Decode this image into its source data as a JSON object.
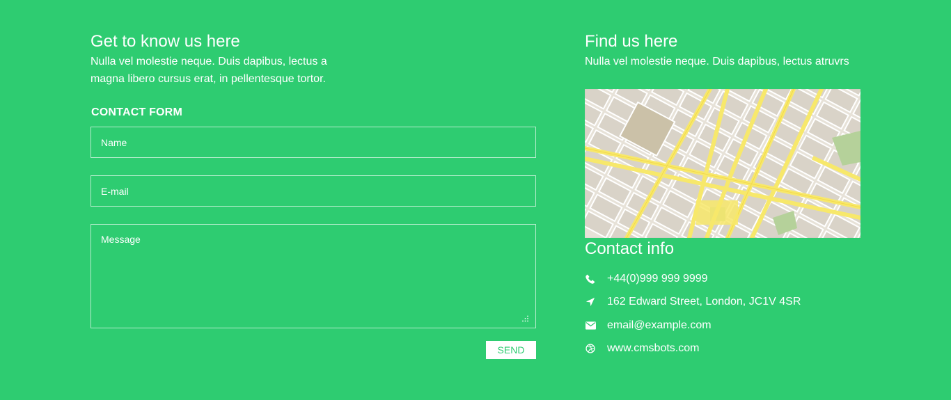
{
  "left": {
    "title": "Get to know us here",
    "description": "Nulla vel molestie neque. Duis dapibus, lectus a magna libero cursus erat, in pellentesque tortor.",
    "form": {
      "heading": "CONTACT FORM",
      "name_placeholder": "Name",
      "email_placeholder": "E-mail",
      "message_placeholder": "Message",
      "send_label": "SEND"
    }
  },
  "right": {
    "title": "Find us here",
    "description": "Nulla vel molestie neque. Duis dapibus, lectus atruvrs",
    "map": {
      "icon": "street-map"
    },
    "contact": {
      "title": "Contact info",
      "items": [
        {
          "icon": "phone-icon",
          "text": "+44(0)999 999 9999"
        },
        {
          "icon": "location-arrow-icon",
          "text": "162 Edward Street, London, JC1V 4SR"
        },
        {
          "icon": "envelope-icon",
          "text": "email@example.com"
        },
        {
          "icon": "dribbble-icon",
          "text": "www.cmsbots.com"
        }
      ]
    }
  },
  "colors": {
    "background": "#2ecc71",
    "text": "#ffffff",
    "button_bg": "#ffffff",
    "button_text": "#2ecc71",
    "map_road_major": "#f7e86b",
    "map_block": "#d9d3c8",
    "map_park": "#b5d19a"
  }
}
